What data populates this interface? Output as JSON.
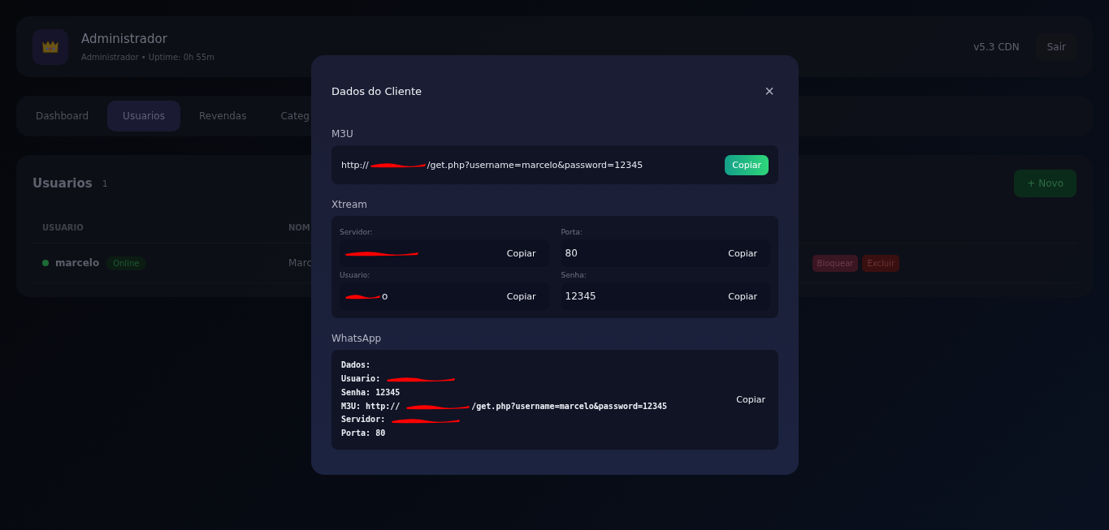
{
  "header": {
    "title": "Administrador",
    "subtitle": "Administrador • Uptime: 0h 55m",
    "version": "v5.3 CDN",
    "logout": "Sair"
  },
  "tabs": [
    {
      "label": "Dashboard",
      "selected": false
    },
    {
      "label": "Usuarios",
      "selected": true
    },
    {
      "label": "Revendas",
      "selected": false
    },
    {
      "label": "Categ",
      "selected": false
    }
  ],
  "users": {
    "title": "Usuarios",
    "count": "1",
    "new_button": "+ Novo",
    "columns": [
      "USUARIO",
      "NOM"
    ],
    "rows": [
      {
        "username": "marcelo",
        "status": "Online",
        "online": true,
        "name": "Marc",
        "actions": [
          "Bloquear",
          "Excluir"
        ]
      }
    ]
  },
  "modal": {
    "title": "Dados do Cliente",
    "close": "×",
    "m3u": {
      "label": "M3U",
      "before": "http://",
      "redacted": true,
      "after": "/get.php?username=marcelo&password=12345",
      "copy": "Copiar"
    },
    "xtream": {
      "label": "Xtream",
      "fields": [
        {
          "label": "Servidor:",
          "redacted": true,
          "copy": "Copiar"
        },
        {
          "label": "Porta:",
          "value": "80",
          "redacted": false,
          "copy": "Copiar"
        },
        {
          "label": "Usuario:",
          "value": "o",
          "redacted": true,
          "copy": "Copiar"
        },
        {
          "label": "Senha:",
          "value": "12345",
          "redacted": false,
          "copy": "Copiar"
        }
      ]
    },
    "whatsapp": {
      "label": "WhatsApp",
      "copy": "Copiar",
      "lines": [
        {
          "before": "Dados:",
          "redacted": false
        },
        {
          "before": "Usuario:",
          "redacted": true
        },
        {
          "before": "Senha: 12345",
          "redacted": false
        },
        {
          "before": "M3U: http://",
          "redacted": true,
          "after": "/get.php?username=marcelo&password=12345"
        },
        {
          "before": "Servidor:",
          "redacted": true
        },
        {
          "before": "Porta: 80",
          "redacted": false
        }
      ]
    }
  }
}
